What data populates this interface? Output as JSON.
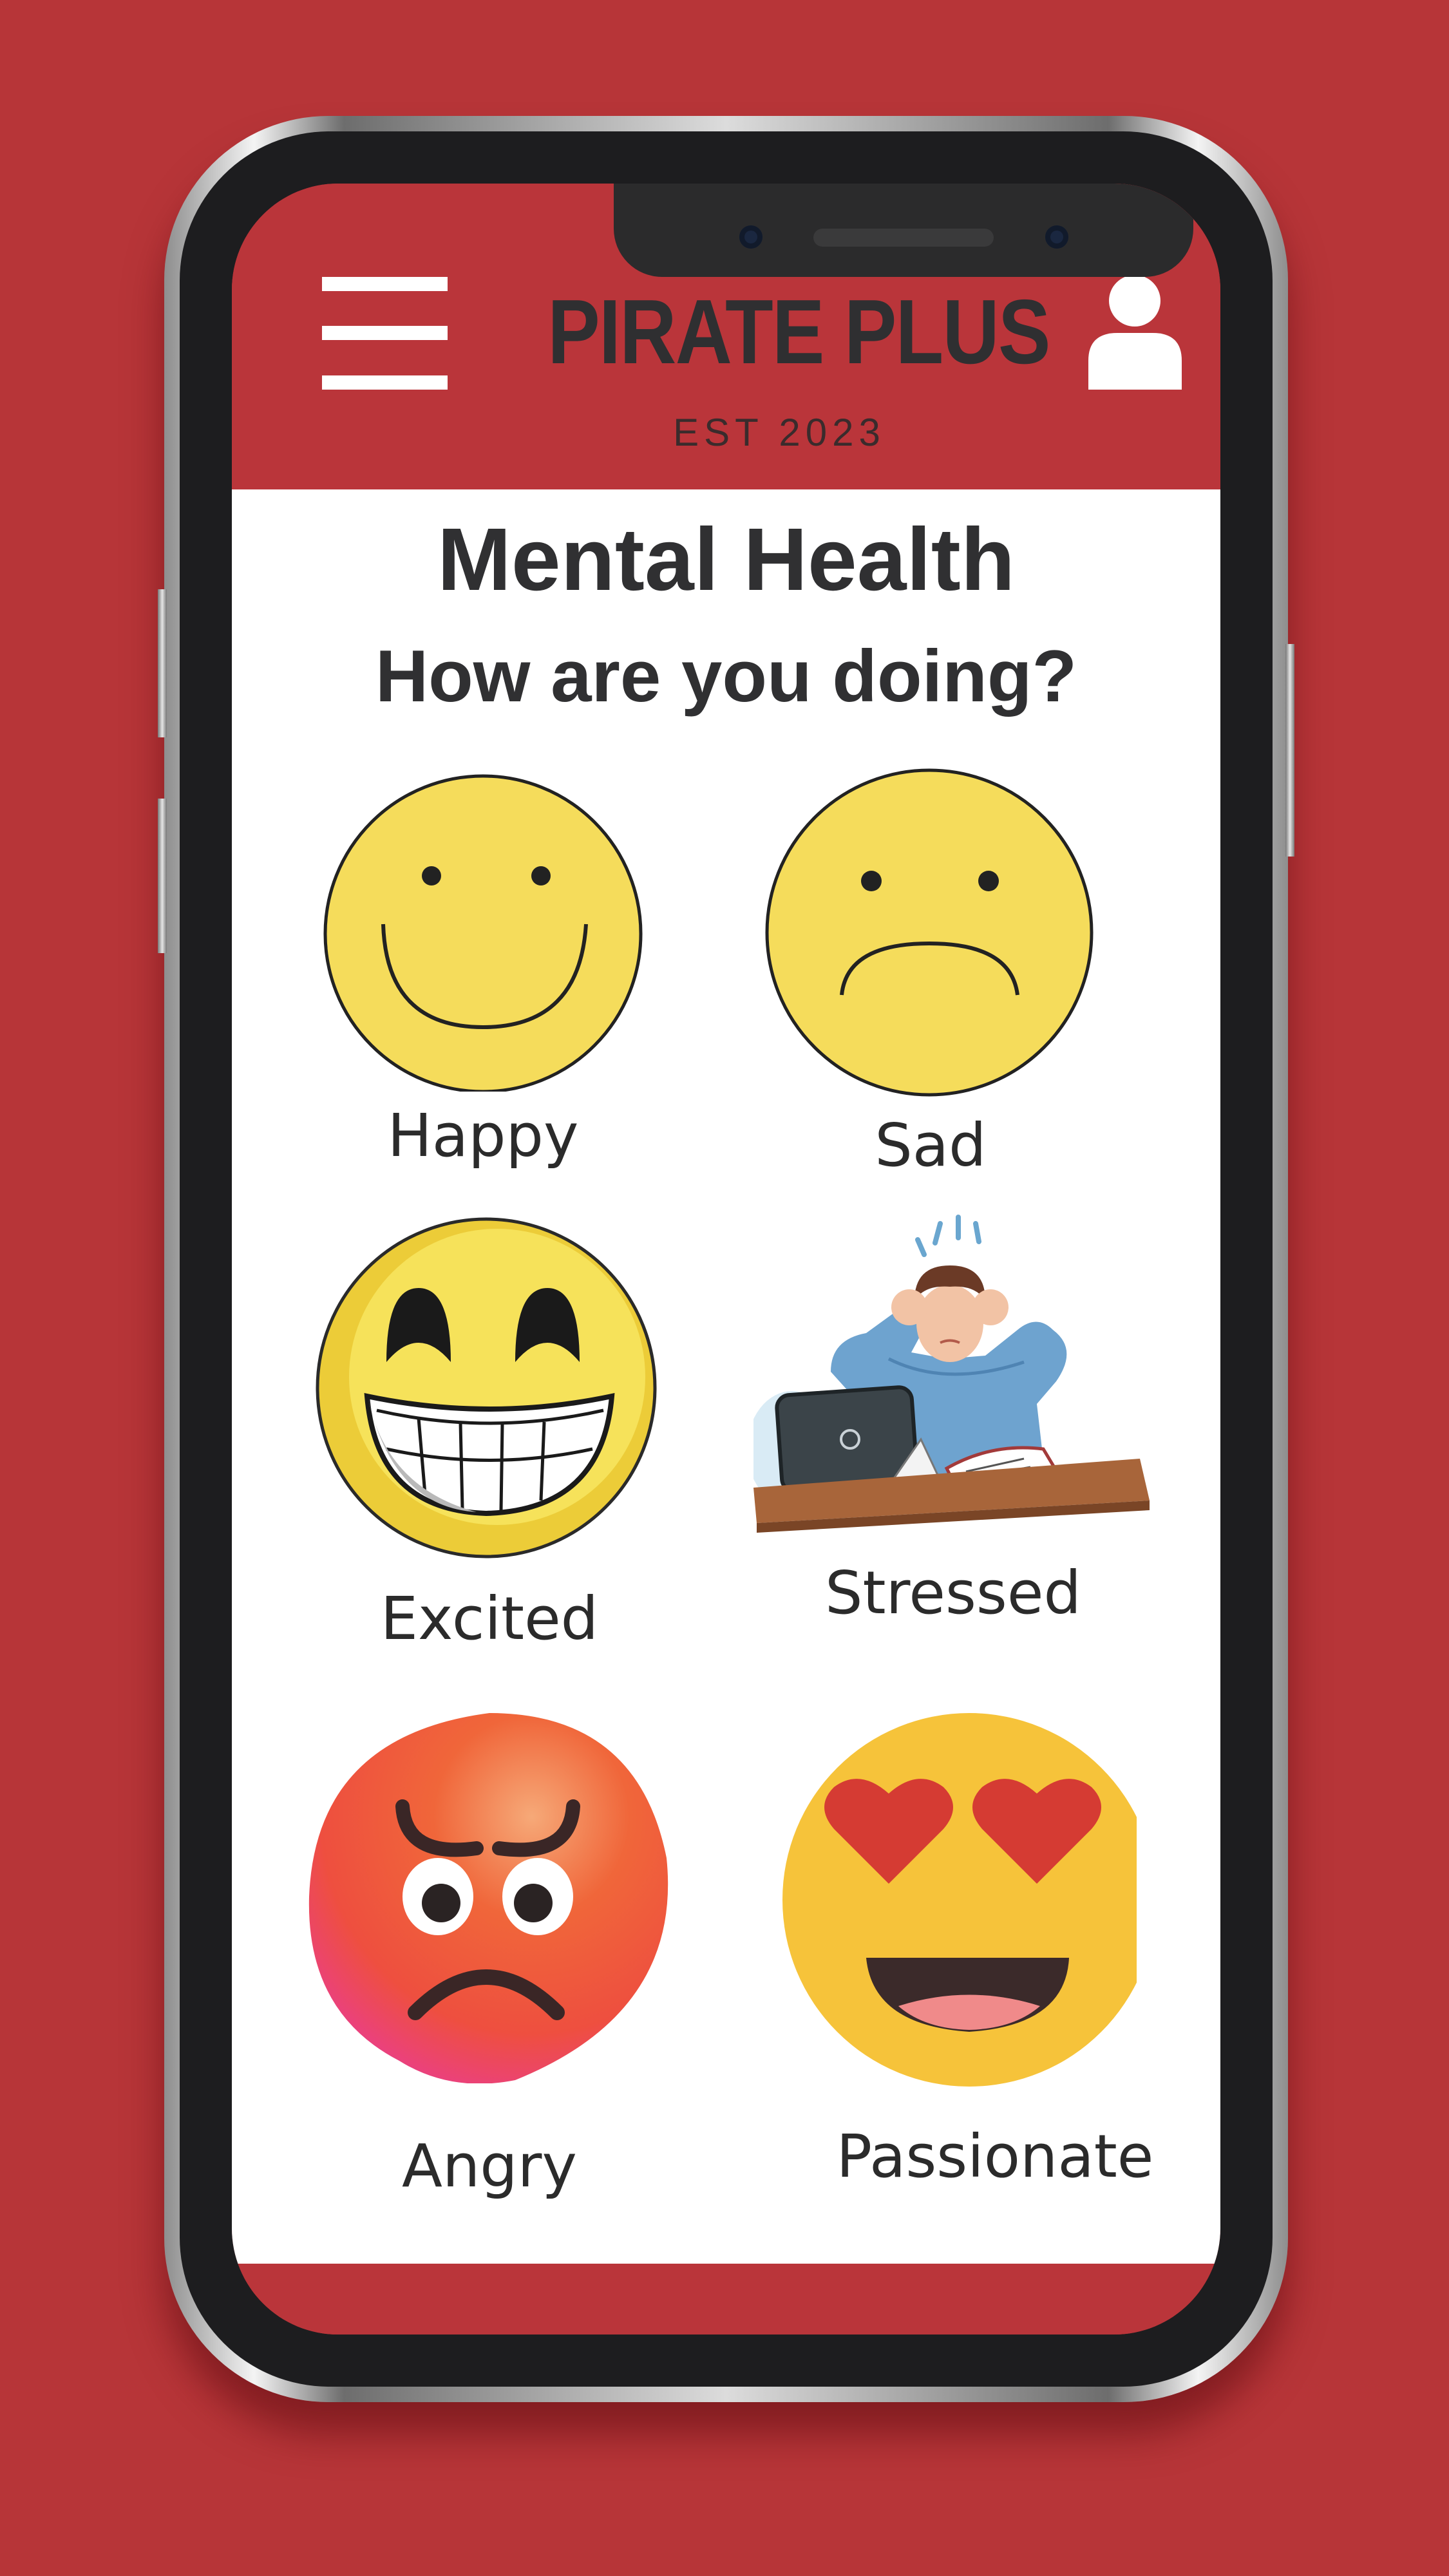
{
  "app": {
    "brand": "PIRATE PLUS",
    "established": "EST 2023",
    "menu_icon": "hamburger-menu-icon",
    "profile_icon": "user-profile-icon"
  },
  "page": {
    "title": "Mental Health",
    "prompt": "How are you doing?"
  },
  "moods": [
    {
      "label": "Happy",
      "icon": "happy-face-icon"
    },
    {
      "label": "Sad",
      "icon": "sad-face-icon"
    },
    {
      "label": "Excited",
      "icon": "grinning-face-icon"
    },
    {
      "label": "Stressed",
      "icon": "stressed-person-illustration"
    },
    {
      "label": "Angry",
      "icon": "angry-face-icon"
    },
    {
      "label": "Passionate",
      "icon": "heart-eyes-face-icon"
    }
  ],
  "colors": {
    "brand_red": "#ba353a",
    "background_red": "#b73538",
    "text_dark": "#303032",
    "face_yellow": "#f5dc5b"
  }
}
